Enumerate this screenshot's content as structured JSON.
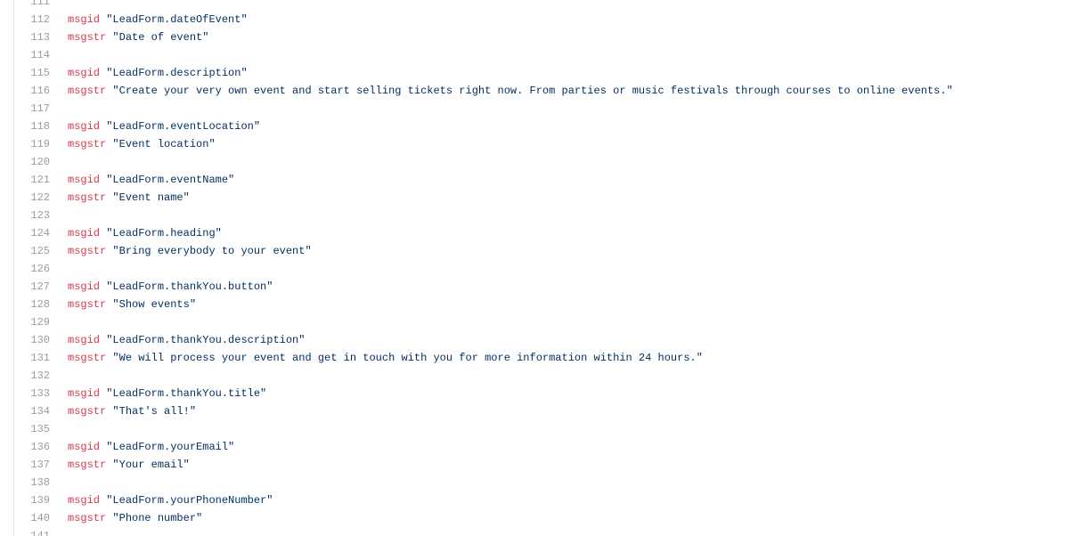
{
  "lines": [
    {
      "num": "111",
      "kw": "",
      "str": ""
    },
    {
      "num": "112",
      "kw": "msgid",
      "str": "\"LeadForm.dateOfEvent\""
    },
    {
      "num": "113",
      "kw": "msgstr",
      "str": "\"Date of event\""
    },
    {
      "num": "114",
      "kw": "",
      "str": ""
    },
    {
      "num": "115",
      "kw": "msgid",
      "str": "\"LeadForm.description\""
    },
    {
      "num": "116",
      "kw": "msgstr",
      "str": "\"Create your very own event and start selling tickets right now. From parties or music festivals through courses to online events.\""
    },
    {
      "num": "117",
      "kw": "",
      "str": ""
    },
    {
      "num": "118",
      "kw": "msgid",
      "str": "\"LeadForm.eventLocation\""
    },
    {
      "num": "119",
      "kw": "msgstr",
      "str": "\"Event location\""
    },
    {
      "num": "120",
      "kw": "",
      "str": ""
    },
    {
      "num": "121",
      "kw": "msgid",
      "str": "\"LeadForm.eventName\""
    },
    {
      "num": "122",
      "kw": "msgstr",
      "str": "\"Event name\""
    },
    {
      "num": "123",
      "kw": "",
      "str": ""
    },
    {
      "num": "124",
      "kw": "msgid",
      "str": "\"LeadForm.heading\""
    },
    {
      "num": "125",
      "kw": "msgstr",
      "str": "\"Bring everybody to your event\""
    },
    {
      "num": "126",
      "kw": "",
      "str": ""
    },
    {
      "num": "127",
      "kw": "msgid",
      "str": "\"LeadForm.thankYou.button\""
    },
    {
      "num": "128",
      "kw": "msgstr",
      "str": "\"Show events\""
    },
    {
      "num": "129",
      "kw": "",
      "str": ""
    },
    {
      "num": "130",
      "kw": "msgid",
      "str": "\"LeadForm.thankYou.description\""
    },
    {
      "num": "131",
      "kw": "msgstr",
      "str": "\"We will process your event and get in touch with you for more information within 24 hours.\""
    },
    {
      "num": "132",
      "kw": "",
      "str": ""
    },
    {
      "num": "133",
      "kw": "msgid",
      "str": "\"LeadForm.thankYou.title\""
    },
    {
      "num": "134",
      "kw": "msgstr",
      "str": "\"That's all!\""
    },
    {
      "num": "135",
      "kw": "",
      "str": ""
    },
    {
      "num": "136",
      "kw": "msgid",
      "str": "\"LeadForm.yourEmail\""
    },
    {
      "num": "137",
      "kw": "msgstr",
      "str": "\"Your email\""
    },
    {
      "num": "138",
      "kw": "",
      "str": ""
    },
    {
      "num": "139",
      "kw": "msgid",
      "str": "\"LeadForm.yourPhoneNumber\""
    },
    {
      "num": "140",
      "kw": "msgstr",
      "str": "\"Phone number\""
    },
    {
      "num": "141",
      "kw": "",
      "str": ""
    }
  ],
  "colors": {
    "keyword": "#d73a49",
    "string": "#032f62",
    "line_number": "#959da5",
    "border": "#e1e4e8"
  }
}
